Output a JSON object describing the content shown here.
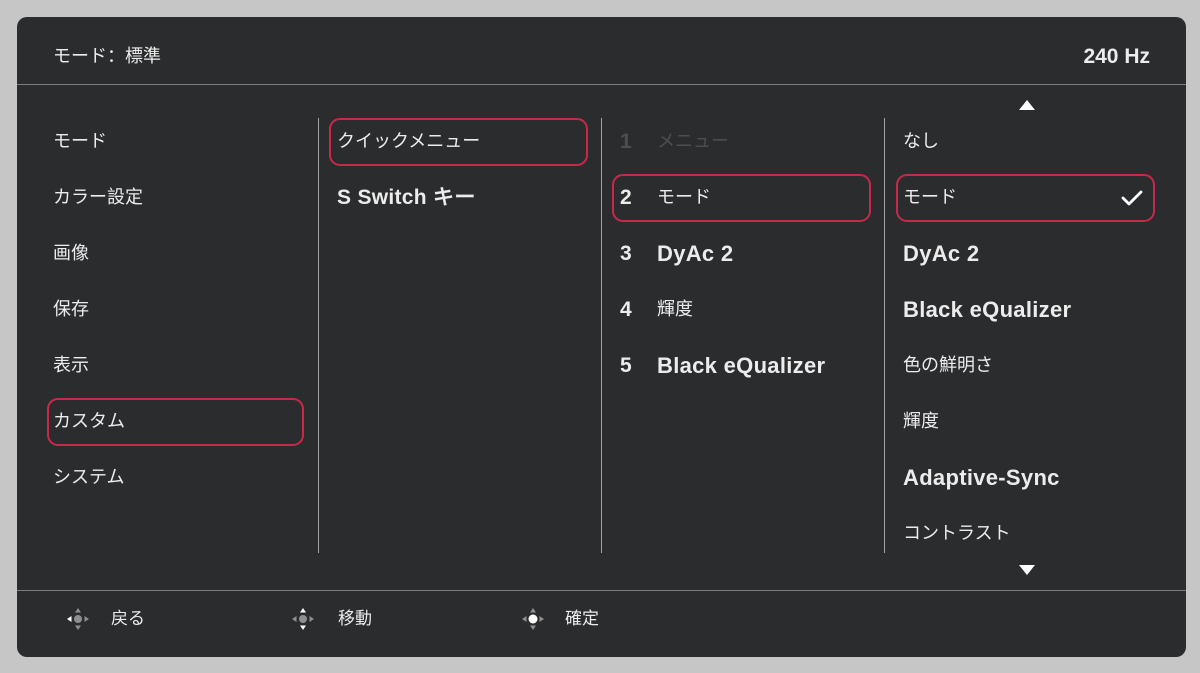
{
  "colors": {
    "accent": "#c8294b",
    "text": "#ececec",
    "disabled": "#4e4e4e",
    "panel": "#2b2c2e",
    "background": "#c6c6c6",
    "divider": "#a4a4a4"
  },
  "header": {
    "mode_label": "モード：標準",
    "refresh_rate": "240 Hz"
  },
  "columns": {
    "main_menu": {
      "items": [
        {
          "label": "モード",
          "selected": false
        },
        {
          "label": "カラー設定",
          "selected": false
        },
        {
          "label": "画像",
          "selected": false
        },
        {
          "label": "保存",
          "selected": false
        },
        {
          "label": "表示",
          "selected": false
        },
        {
          "label": "カスタム",
          "selected": true
        },
        {
          "label": "システム",
          "selected": false
        }
      ]
    },
    "custom_menu": {
      "items": [
        {
          "label": "クイックメニュー",
          "selected": true
        },
        {
          "label": "S Switch キー",
          "selected": false
        }
      ]
    },
    "quick_menu_slots": {
      "items": [
        {
          "number": "1",
          "label": "メニュー",
          "disabled": true,
          "selected": false
        },
        {
          "number": "2",
          "label": "モード",
          "disabled": false,
          "selected": true
        },
        {
          "number": "3",
          "label": "DyAc 2",
          "disabled": false,
          "selected": false
        },
        {
          "number": "4",
          "label": "輝度",
          "disabled": false,
          "selected": false
        },
        {
          "number": "5",
          "label": "Black eQualizer",
          "disabled": false,
          "selected": false
        }
      ]
    },
    "slot_options": {
      "scroll_up_icon": "triangle-up",
      "scroll_down_icon": "triangle-down",
      "check_icon": "checkmark",
      "items": [
        {
          "label": "なし",
          "selected": false,
          "checked": false
        },
        {
          "label": "モード",
          "selected": true,
          "checked": true
        },
        {
          "label": "DyAc 2",
          "selected": false,
          "checked": false
        },
        {
          "label": "Black eQualizer",
          "selected": false,
          "checked": false
        },
        {
          "label": "色の鮮明さ",
          "selected": false,
          "checked": false
        },
        {
          "label": "輝度",
          "selected": false,
          "checked": false
        },
        {
          "label": "Adaptive-Sync",
          "selected": false,
          "checked": false
        },
        {
          "label": "コントラスト",
          "selected": false,
          "checked": false
        }
      ]
    }
  },
  "footer": {
    "hints": [
      {
        "icon": "joystick-left",
        "label": "戻る"
      },
      {
        "icon": "joystick-up-down",
        "label": "移動"
      },
      {
        "icon": "joystick-press",
        "label": "確定"
      }
    ]
  }
}
